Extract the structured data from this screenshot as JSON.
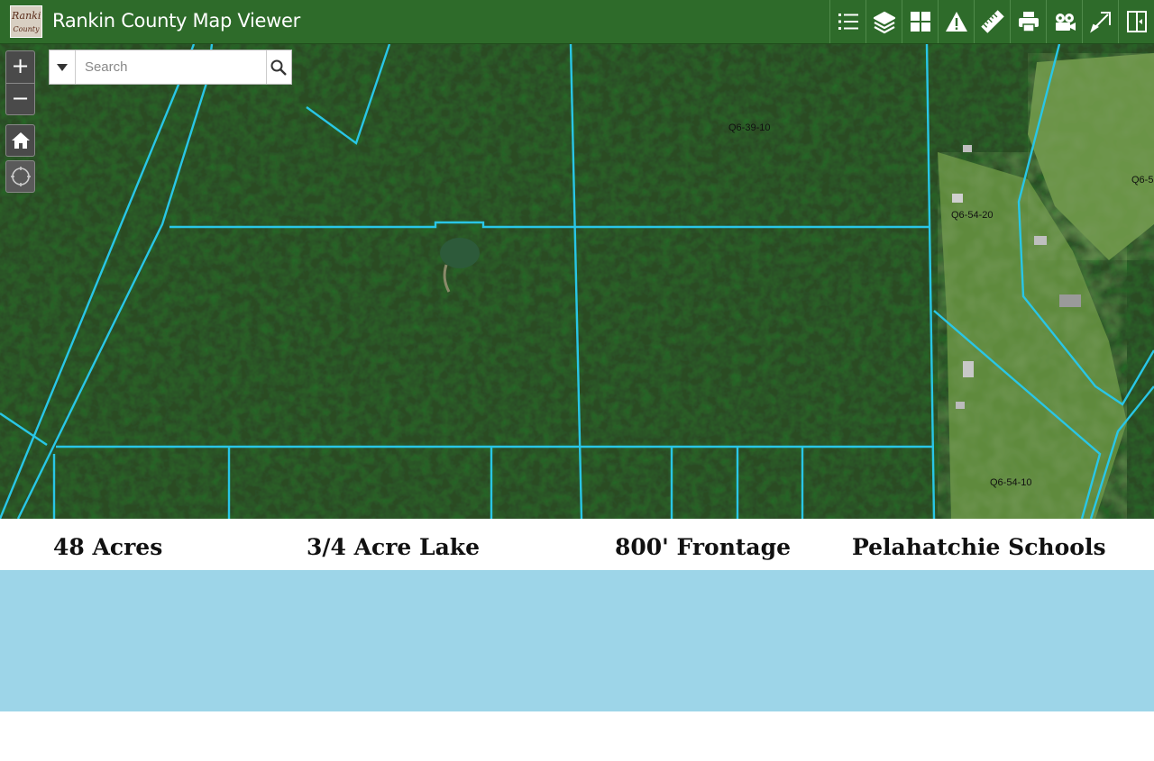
{
  "header": {
    "title": "Rankin County Map Viewer",
    "logo_text": [
      "Rankin",
      "County"
    ],
    "tools": [
      "legend-icon",
      "layers-icon",
      "basemap-gallery-icon",
      "warning-icon",
      "measure-icon",
      "print-icon",
      "film-icon",
      "draw-icon",
      "split-view-icon"
    ]
  },
  "map_controls": {
    "zoom_in": "+",
    "zoom_out": "−"
  },
  "search": {
    "placeholder": "Search",
    "value": ""
  },
  "parcel_labels": [
    "Q6-39-10",
    "Q6-54-20",
    "Q6-54-10",
    "Q6-5"
  ],
  "features": [
    "48 Acres",
    "3/4 Acre Lake",
    "800' Frontage",
    "Pelahatchie Schools"
  ],
  "colors": {
    "header_bg": "#2e6b2a",
    "parcel_line": "#29c6e6",
    "band": "#9dd5e8"
  }
}
